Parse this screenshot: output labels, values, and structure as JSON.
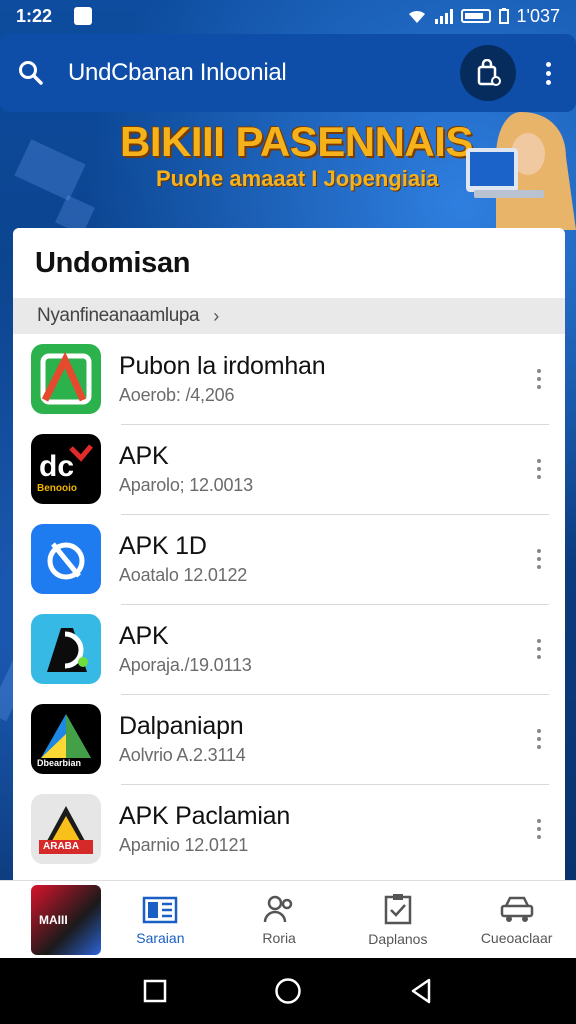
{
  "status_bar": {
    "time": "1:22",
    "right_text": "1'037"
  },
  "app_bar": {
    "title": "UndCbanan Inloonial"
  },
  "promo": {
    "headline": "BIKIII PASENNAIS",
    "subtitle": "Puohe amaaat I Jopengiaia"
  },
  "card": {
    "title": "Undomisan",
    "breadcrumb": "Nyanfineanaamlupa"
  },
  "apps": [
    {
      "name": "Pubon la irdomhan",
      "meta": "Aoerob: /4,206"
    },
    {
      "name": "APK",
      "meta": "Aparolo; 12.0013",
      "badge_text": "Benooio"
    },
    {
      "name": "APK   1D",
      "meta": "Aoatalo 12.0122"
    },
    {
      "name": "APK",
      "meta": "Aporaja./19.0113"
    },
    {
      "name": "Dalpaniapn",
      "meta": "Aolvrio A.2.3114",
      "badge_text": "Dbearbian"
    },
    {
      "name": "APK Paclamian",
      "meta": "Aparnio 12.0121",
      "badge_text": "ARABA"
    }
  ],
  "bottom_nav": [
    {
      "label": "Saraian",
      "icon": "news-icon",
      "active": true
    },
    {
      "label": "Roria",
      "icon": "people-icon",
      "active": false
    },
    {
      "label": "Daplanos",
      "icon": "clipboard-check-icon",
      "active": false
    },
    {
      "label": "Cueoaclaar",
      "icon": "car-icon",
      "active": false
    }
  ],
  "bottom_thumb_text": "MAIII",
  "colors": {
    "app_bar": "#0e4ea8",
    "accent": "#1a5fc4",
    "promo_text": "#f6b21b"
  }
}
